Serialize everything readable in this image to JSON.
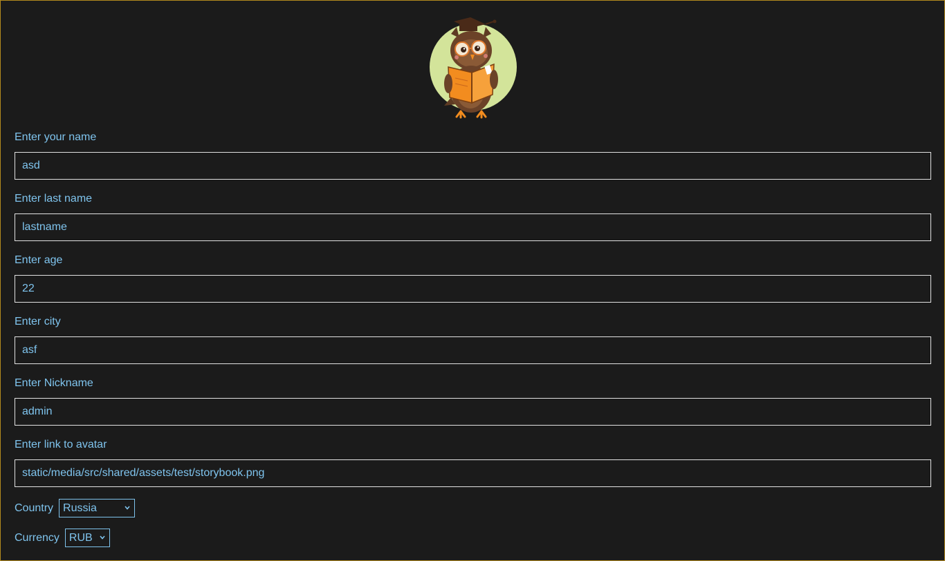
{
  "form": {
    "fields": [
      {
        "label": "Enter your name",
        "value": "asd"
      },
      {
        "label": "Enter last name",
        "value": "lastname"
      },
      {
        "label": "Enter age",
        "value": "22"
      },
      {
        "label": "Enter city",
        "value": "asf"
      },
      {
        "label": "Enter Nickname",
        "value": "admin"
      },
      {
        "label": "Enter link to avatar",
        "value": "static/media/src/shared/assets/test/storybook.png"
      }
    ],
    "country": {
      "label": "Country",
      "value": "Russia"
    },
    "currency": {
      "label": "Currency",
      "value": "RUB"
    }
  },
  "colors": {
    "background": "#1b1b1b",
    "text": "#7fc4ee",
    "frame_border": "#b48a1e",
    "input_border": "#e3e3e3"
  },
  "icons": {
    "avatar": "owl-reading-book-icon",
    "select_arrow": "chevron-down-icon"
  }
}
